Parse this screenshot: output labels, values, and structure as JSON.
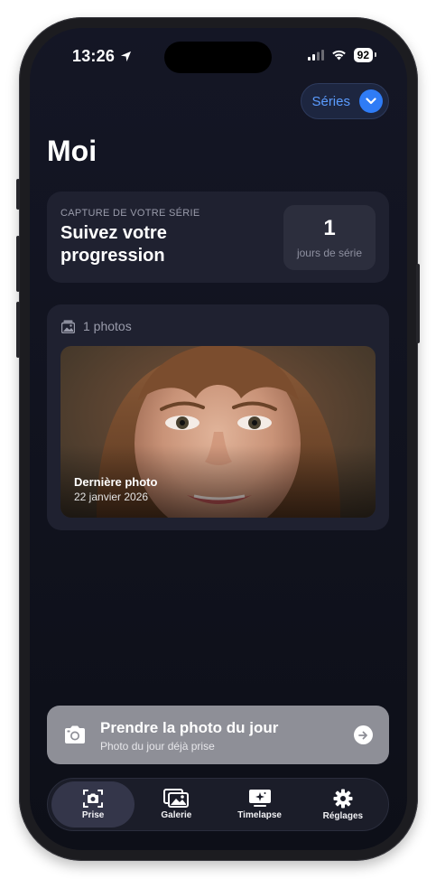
{
  "status_bar": {
    "time": "13:26",
    "battery": "92"
  },
  "header": {
    "series_label": "Séries",
    "title": "Moi"
  },
  "streak_card": {
    "eyebrow": "CAPTURE DE VOTRE SÉRIE",
    "heading": "Suivez votre progression",
    "count": "1",
    "unit": "jours de série"
  },
  "photos_card": {
    "count_label": "1 photos",
    "latest_title": "Dernière photo",
    "latest_date": "22 janvier 2026"
  },
  "cta": {
    "title": "Prendre la photo du jour",
    "subtitle": "Photo du jour déjà prise"
  },
  "tabs": [
    {
      "label": "Prise",
      "icon": "camera-viewfinder-icon",
      "active": true
    },
    {
      "label": "Galerie",
      "icon": "photo-stack-icon",
      "active": false
    },
    {
      "label": "Timelapse",
      "icon": "sparkle-screen-icon",
      "active": false
    },
    {
      "label": "Réglages",
      "icon": "gear-icon",
      "active": false
    }
  ],
  "colors": {
    "accent": "#2F7CF6",
    "background": "#11131E",
    "card": "#1F2130"
  }
}
